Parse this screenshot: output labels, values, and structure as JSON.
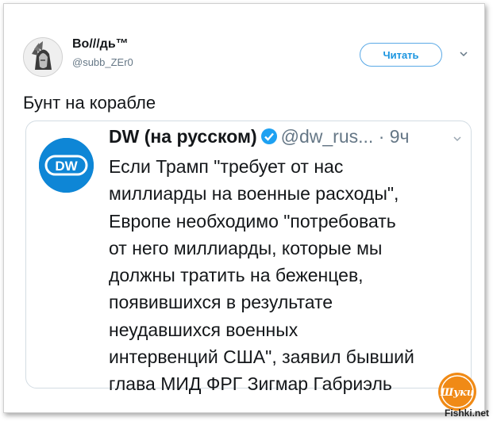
{
  "user": {
    "display_name": "Во///дь™",
    "handle": "@subb_ZEr0",
    "avatar_icon": "tribal-portrait-avatar"
  },
  "actions": {
    "follow_label": "Читать",
    "menu_icon": "chevron-down-icon"
  },
  "tweet": {
    "text": "Бунт на корабле"
  },
  "quoted_tweet": {
    "logo_text": "DW",
    "name": "DW (на русском)",
    "verified_icon": "verified-badge-icon",
    "handle": "@dw_rus...",
    "time": "· 9ч",
    "lines": [
      "Если Трамп \"требует от нас",
      "миллиарды на военные расходы\",",
      "Европе необходимо \"потребовать",
      "от него миллиарды, которые мы",
      "должны тратить на беженцев,",
      "появившихся в результате",
      "неудавшихся военных",
      "интервенций США\", заявил бывший",
      "глава МИД ФРГ Зигмар Габриэль"
    ]
  },
  "watermark": {
    "badge_text": "Шуки",
    "site": "Fishki.net"
  },
  "colors": {
    "accent": "#1b95e0",
    "dw_blue": "#0e86d6",
    "text": "#14171a",
    "muted": "#657786",
    "watermark": "#f08a16"
  }
}
